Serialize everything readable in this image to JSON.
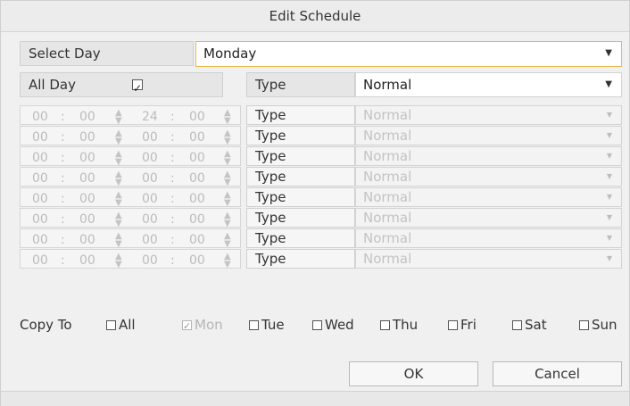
{
  "window": {
    "title": "Edit Schedule"
  },
  "select_day": {
    "label": "Select Day",
    "value": "Monday"
  },
  "all_day": {
    "label": "All Day",
    "checked": true
  },
  "top_type": {
    "label": "Type",
    "value": "Normal"
  },
  "periods": [
    {
      "start_h": "00",
      "start_m": "00",
      "end_h": "24",
      "end_m": "00",
      "type_label": "Type",
      "type_value": "Normal"
    },
    {
      "start_h": "00",
      "start_m": "00",
      "end_h": "00",
      "end_m": "00",
      "type_label": "Type",
      "type_value": "Normal"
    },
    {
      "start_h": "00",
      "start_m": "00",
      "end_h": "00",
      "end_m": "00",
      "type_label": "Type",
      "type_value": "Normal"
    },
    {
      "start_h": "00",
      "start_m": "00",
      "end_h": "00",
      "end_m": "00",
      "type_label": "Type",
      "type_value": "Normal"
    },
    {
      "start_h": "00",
      "start_m": "00",
      "end_h": "00",
      "end_m": "00",
      "type_label": "Type",
      "type_value": "Normal"
    },
    {
      "start_h": "00",
      "start_m": "00",
      "end_h": "00",
      "end_m": "00",
      "type_label": "Type",
      "type_value": "Normal"
    },
    {
      "start_h": "00",
      "start_m": "00",
      "end_h": "00",
      "end_m": "00",
      "type_label": "Type",
      "type_value": "Normal"
    },
    {
      "start_h": "00",
      "start_m": "00",
      "end_h": "00",
      "end_m": "00",
      "type_label": "Type",
      "type_value": "Normal"
    }
  ],
  "time_separator": ":",
  "copy_to": {
    "label": "Copy To",
    "options": [
      {
        "label": "All",
        "checked": false,
        "disabled": false
      },
      {
        "label": "Mon",
        "checked": true,
        "disabled": true
      },
      {
        "label": "Tue",
        "checked": false,
        "disabled": false
      },
      {
        "label": "Wed",
        "checked": false,
        "disabled": false
      },
      {
        "label": "Thu",
        "checked": false,
        "disabled": false
      },
      {
        "label": "Fri",
        "checked": false,
        "disabled": false
      },
      {
        "label": "Sat",
        "checked": false,
        "disabled": false
      },
      {
        "label": "Sun",
        "checked": false,
        "disabled": false
      }
    ]
  },
  "buttons": {
    "ok": "OK",
    "cancel": "Cancel"
  },
  "colors": {
    "focus_border": "#e7b84a",
    "disabled_text": "#c3c3c3",
    "background": "#f0f0f0"
  }
}
